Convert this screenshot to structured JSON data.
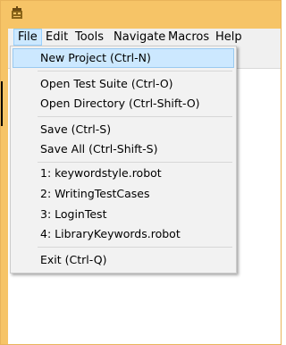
{
  "menubar": {
    "items": [
      {
        "label": "File",
        "active": true
      },
      {
        "label": "Edit"
      },
      {
        "label": "Tools"
      },
      {
        "label": "Navigate"
      },
      {
        "label": "Macros"
      },
      {
        "label": "Help"
      }
    ]
  },
  "file_menu": {
    "items": [
      {
        "label": "New Project    (Ctrl-N)",
        "highlighted": true
      },
      {
        "label": "Open Test Suite    (Ctrl-O)"
      },
      {
        "label": "Open Directory    (Ctrl-Shift-O)"
      },
      {
        "label": "Save    (Ctrl-S)"
      },
      {
        "label": "Save All    (Ctrl-Shift-S)"
      },
      {
        "label": "1: keywordstyle.robot"
      },
      {
        "label": "2: WritingTestCases"
      },
      {
        "label": "3: LoginTest"
      },
      {
        "label": "4: LibraryKeywords.robot"
      },
      {
        "label": "Exit    (Ctrl-Q)"
      }
    ]
  },
  "colors": {
    "frame": "#f6c467",
    "menu_highlight": "#cce8ff",
    "menu_bg": "#f2f2f2"
  },
  "icons": {
    "app": "robot-app-icon"
  }
}
